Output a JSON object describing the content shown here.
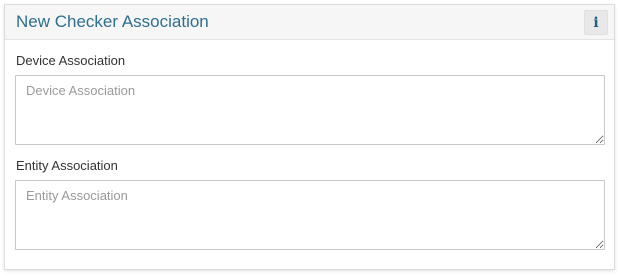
{
  "panel": {
    "title": "New Checker Association",
    "info_button_label": "i"
  },
  "fields": [
    {
      "label": "Device Association",
      "placeholder": "Device Association",
      "value": ""
    },
    {
      "label": "Entity Association",
      "placeholder": "Entity Association",
      "value": ""
    }
  ]
}
